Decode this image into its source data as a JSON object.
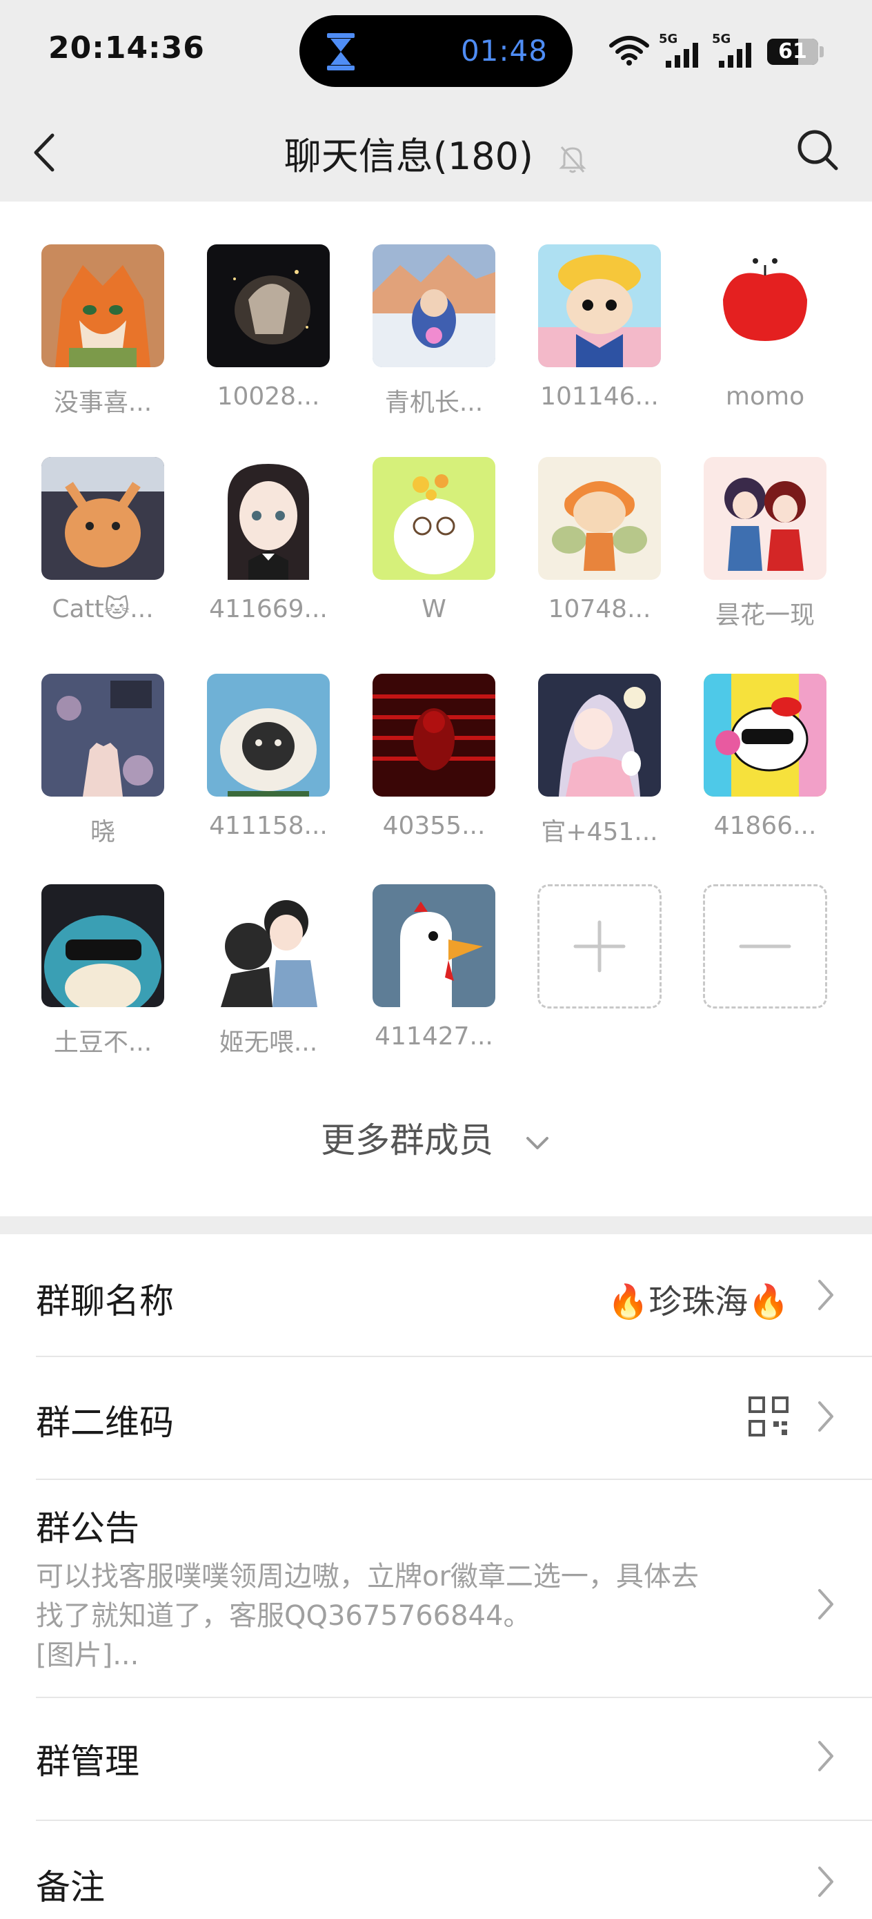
{
  "status_bar": {
    "time": "20:14:36",
    "timer": "01:48",
    "network_1": "5G",
    "network_2": "5G",
    "battery": "61",
    "battery_level_percent": 61
  },
  "nav": {
    "title": "聊天信息(180)"
  },
  "members": [
    {
      "name": "没事喜..."
    },
    {
      "name": "10028..."
    },
    {
      "name": "青机长..."
    },
    {
      "name": "101146..."
    },
    {
      "name": "momo"
    },
    {
      "name": "Catt🐱..."
    },
    {
      "name": "411669..."
    },
    {
      "name": "W"
    },
    {
      "name": "10748..."
    },
    {
      "name": "昙花一现"
    },
    {
      "name": "晓"
    },
    {
      "name": "411158..."
    },
    {
      "name": "40355..."
    },
    {
      "name": "官+451..."
    },
    {
      "name": "41866..."
    },
    {
      "name": "土豆不..."
    },
    {
      "name": "姬无喂..."
    },
    {
      "name": "411427..."
    }
  ],
  "more_members_label": "更多群成员",
  "settings": {
    "group_name_label": "群聊名称",
    "group_name_value": "🔥珍珠海🔥",
    "qr_label": "群二维码",
    "notice_label": "群公告",
    "notice_line1": "可以找客服噗噗领周边嗷，立牌or徽章二选一，具体去",
    "notice_line2": "找了就知道了，客服QQ3675766844。",
    "notice_line3": "[图片]...",
    "manage_label": "群管理",
    "remark_label": "备注"
  },
  "colors": {
    "nav_bg": "#ededed",
    "accent_blue": "#4f8df5",
    "muted_text": "#9a9a9a"
  }
}
